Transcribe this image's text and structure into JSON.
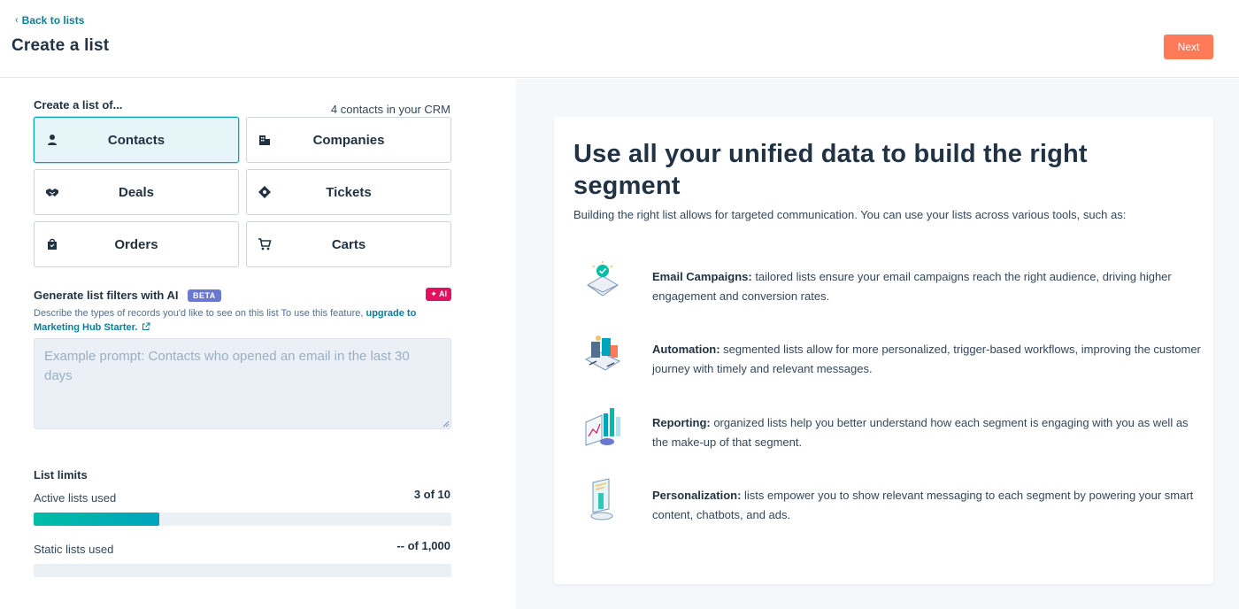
{
  "header": {
    "back_label": "Back to lists",
    "title": "Create a list",
    "next_label": "Next"
  },
  "colors": {
    "accent": "#00a4bd",
    "cta": "#ff7a59",
    "link": "#0b7f98",
    "ai_badge": "#e0115f",
    "beta_badge": "#6a78d1"
  },
  "left": {
    "create_title": "Create a list of...",
    "crm_count": "4 contacts in your CRM",
    "objects": [
      {
        "label": "Contacts",
        "icon": "contact-icon",
        "selected": true
      },
      {
        "label": "Companies",
        "icon": "building-icon",
        "selected": false
      },
      {
        "label": "Deals",
        "icon": "handshake-icon",
        "selected": false
      },
      {
        "label": "Tickets",
        "icon": "ticket-icon",
        "selected": false
      },
      {
        "label": "Orders",
        "icon": "shopping-bag-icon",
        "selected": false
      },
      {
        "label": "Carts",
        "icon": "cart-icon",
        "selected": false
      }
    ],
    "ai": {
      "title": "Generate list filters with AI",
      "beta": "BETA",
      "badge": "✦ AI",
      "desc": "Describe the types of records you'd like to see on this list To use this feature, ",
      "upgrade": "upgrade to Marketing Hub Starter.",
      "placeholder": "Example prompt: Contacts who opened an email in the last 30 days",
      "value": ""
    },
    "limits": {
      "title": "List limits",
      "active_label": "Active lists used",
      "active_value": "3 of 10",
      "active_fraction": 0.3,
      "static_label": "Static lists used",
      "static_value": "-- of 1,000",
      "static_fraction": 0
    }
  },
  "right": {
    "title": "Use all your unified data to build the right segment",
    "subtitle": "Building the right list allows for targeted communication. You can use your lists across various tools, such as:",
    "features": [
      {
        "icon": "email-campaign-icon",
        "title": "Email Campaigns:",
        "text": " tailored lists ensure your email campaigns reach the right audience, driving higher engagement and conversion rates."
      },
      {
        "icon": "automation-icon",
        "title": "Automation:",
        "text": " segmented lists allow for more personalized, trigger-based workflows, improving the customer journey with timely and relevant messages."
      },
      {
        "icon": "reporting-icon",
        "title": "Reporting:",
        "text": " organized lists help you better understand how each segment is engaging with you as well as the make-up of that segment."
      },
      {
        "icon": "personalization-icon",
        "title": "Personalization:",
        "text": " lists empower you to show relevant messaging to each segment by powering your smart content, chatbots, and ads."
      }
    ]
  }
}
